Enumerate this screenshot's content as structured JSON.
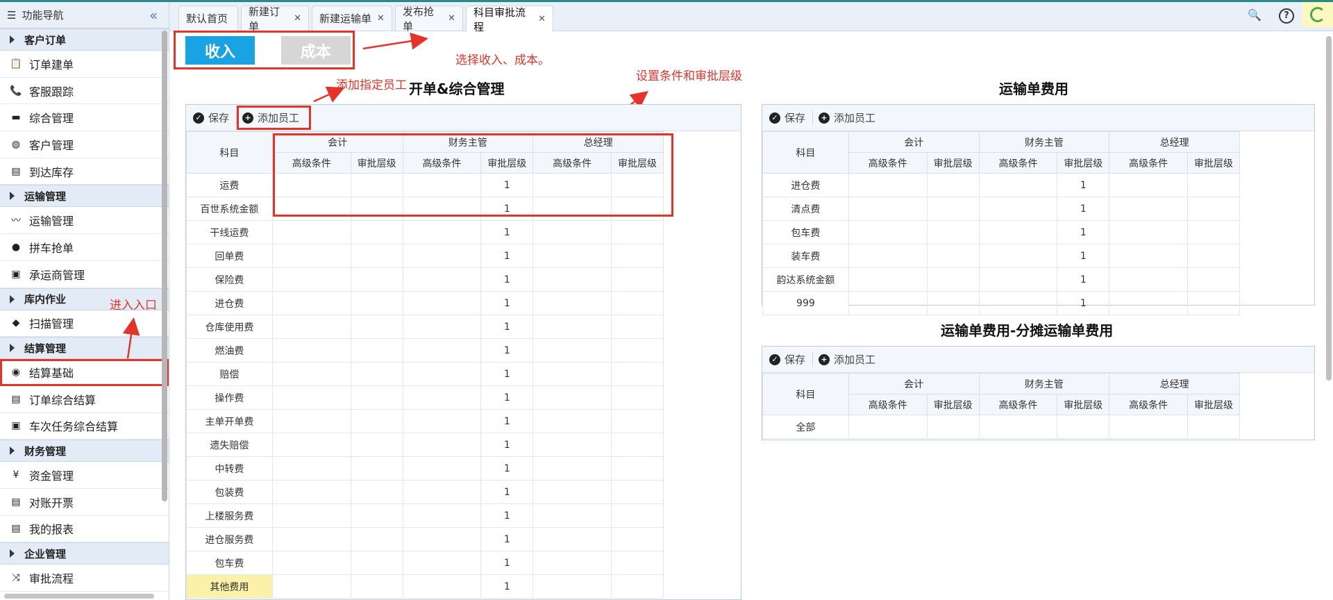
{
  "sidebar": {
    "title": "功能导航",
    "collapse_icon": "double-chevron-left-icon",
    "groups": [
      {
        "label": "客户订单",
        "items": [
          {
            "label": "订单建单",
            "icon": "clipboard-icon"
          },
          {
            "label": "客服跟踪",
            "icon": "phone-icon"
          },
          {
            "label": "综合管理",
            "icon": "monitor-icon"
          },
          {
            "label": "客户管理",
            "icon": "globe-icon"
          },
          {
            "label": "到达库存",
            "icon": "document-icon"
          }
        ]
      },
      {
        "label": "运输管理",
        "items": [
          {
            "label": "运输管理",
            "icon": "route-icon"
          },
          {
            "label": "拼车抢单",
            "icon": "map-pin-icon"
          },
          {
            "label": "承运商管理",
            "icon": "bus-icon"
          }
        ]
      },
      {
        "label": "库内作业",
        "items": [
          {
            "label": "扫描管理",
            "icon": "cube-icon"
          }
        ]
      },
      {
        "label": "结算管理",
        "items": [
          {
            "label": "结算基础",
            "icon": "eye-icon"
          },
          {
            "label": "订单综合结算",
            "icon": "document-icon"
          },
          {
            "label": "车次任务综合结算",
            "icon": "bus-icon"
          }
        ]
      },
      {
        "label": "财务管理",
        "items": [
          {
            "label": "资金管理",
            "icon": "yen-icon"
          },
          {
            "label": "对账开票",
            "icon": "document-icon"
          },
          {
            "label": "我的报表",
            "icon": "document-icon"
          }
        ]
      },
      {
        "label": "企业管理",
        "items": [
          {
            "label": "审批流程",
            "icon": "shuffle-icon"
          }
        ]
      }
    ]
  },
  "tabs": [
    {
      "label": "默认首页",
      "closable": false
    },
    {
      "label": "新建订单",
      "closable": true
    },
    {
      "label": "新建运输单",
      "closable": true
    },
    {
      "label": "发布抢单",
      "closable": true
    },
    {
      "label": "科目审批流程",
      "closable": true,
      "active": true
    }
  ],
  "topbar_icons": [
    "search-icon",
    "help-icon",
    "refresh-icon"
  ],
  "toggle": {
    "income": "收入",
    "cost": "成本"
  },
  "annotations": {
    "select": "选择收入、成本。",
    "add_staff": "添加指定员工",
    "set_conditions": "设置条件和审批层级",
    "entry": "进入入口"
  },
  "toolbar": {
    "save": "保存",
    "add_staff": "添加员工"
  },
  "table_headers": {
    "subject": "科目",
    "roles": [
      "会计",
      "财务主管",
      "总经理"
    ],
    "sub": [
      "高级条件",
      "审批层级"
    ]
  },
  "panels": {
    "kaidan": {
      "title": "开单&综合管理",
      "rows": [
        {
          "subject": "运费",
          "level": "1"
        },
        {
          "subject": "百世系统金额",
          "level": "1"
        },
        {
          "subject": "干线运费",
          "level": "1"
        },
        {
          "subject": "回单费",
          "level": "1"
        },
        {
          "subject": "保险费",
          "level": "1"
        },
        {
          "subject": "进仓费",
          "level": "1"
        },
        {
          "subject": "仓库使用费",
          "level": "1"
        },
        {
          "subject": "燃油费",
          "level": "1"
        },
        {
          "subject": "赔偿",
          "level": "1"
        },
        {
          "subject": "操作费",
          "level": "1"
        },
        {
          "subject": "主单开单费",
          "level": "1"
        },
        {
          "subject": "遗失赔偿",
          "level": "1"
        },
        {
          "subject": "中转费",
          "level": "1"
        },
        {
          "subject": "包装费",
          "level": "1"
        },
        {
          "subject": "上楼服务费",
          "level": "1"
        },
        {
          "subject": "进仓服务费",
          "level": "1"
        },
        {
          "subject": "包车费",
          "level": "1"
        },
        {
          "subject": "其他费用",
          "level": "1",
          "highlight": true
        }
      ]
    },
    "yunshu": {
      "title": "运输单费用",
      "rows": [
        {
          "subject": "进仓费",
          "level": "1"
        },
        {
          "subject": "清点费",
          "level": "1"
        },
        {
          "subject": "包车费",
          "level": "1"
        },
        {
          "subject": "装车费",
          "level": "1"
        },
        {
          "subject": "韵达系统金额",
          "level": "1"
        },
        {
          "subject": "999",
          "level": "1"
        }
      ]
    },
    "fentan": {
      "title": "运输单费用-分摊运输单费用",
      "rows": [
        {
          "subject": "全部",
          "level": ""
        }
      ]
    }
  },
  "colors": {
    "accent_red": "#e5332a",
    "income_blue": "#19a3e2",
    "cost_gray": "#d6d6d6"
  }
}
